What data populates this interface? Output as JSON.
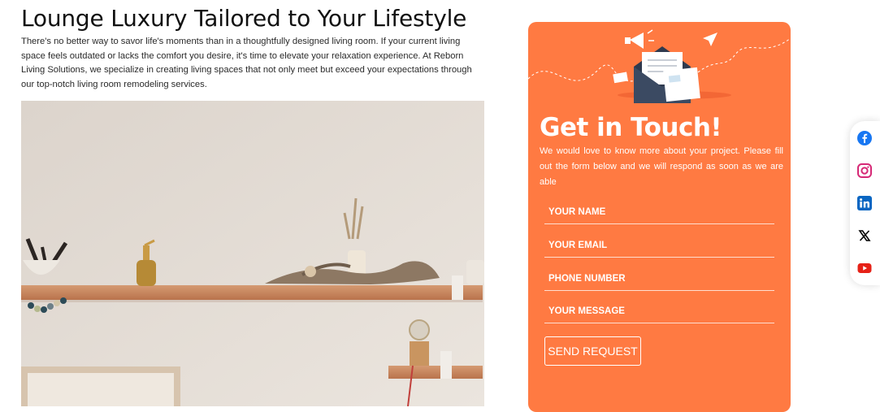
{
  "page": {
    "title": "Lounge Luxury Tailored to Your Lifestyle",
    "intro": "There's no better way to savor life's moments than in a thoughtfully designed living room. If your current living space feels outdated or lacks the comfort you desire, it's time to elevate your relaxation experience. At Reborn Living Solutions, we specialize in creating living spaces that not only meet but exceed your expectations through our top-notch living room remodeling services."
  },
  "contact_form": {
    "heading": "Get in Touch!",
    "subtext": "We would love to know more about your project. Please fill out the form below and we will respond as soon as we are able",
    "fields": {
      "name": {
        "placeholder": "YOUR NAME"
      },
      "email": {
        "placeholder": "YOUR EMAIL"
      },
      "phone": {
        "placeholder": "PHONE NUMBER"
      },
      "message": {
        "placeholder": "YOUR MESSAGE"
      }
    },
    "submit_label": "SEND REQUEST",
    "accent_color": "#ff7a42"
  },
  "social": [
    {
      "icon": "facebook-icon",
      "color": "#1877f2"
    },
    {
      "icon": "instagram-icon",
      "color": "#d62976"
    },
    {
      "icon": "linkedin-icon",
      "color": "#0a66c2"
    },
    {
      "icon": "x-icon",
      "color": "#000000"
    },
    {
      "icon": "youtube-icon",
      "color": "#e62117"
    }
  ]
}
